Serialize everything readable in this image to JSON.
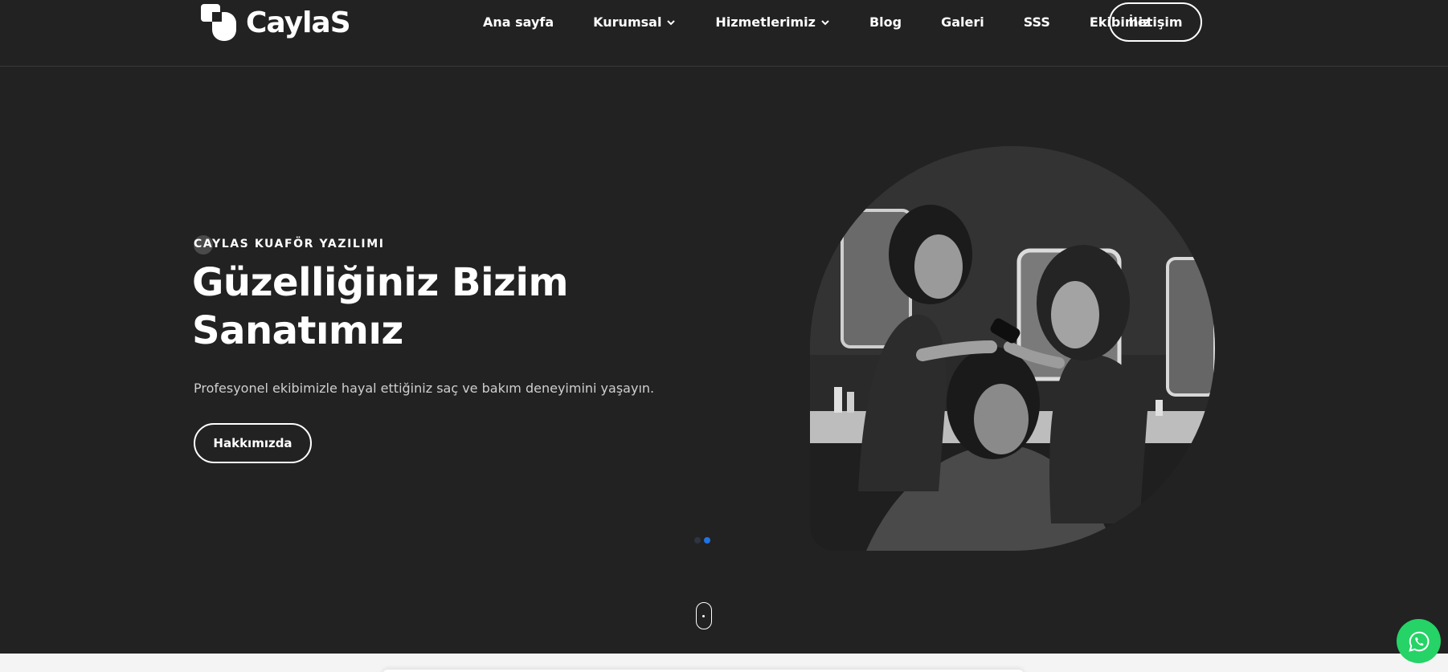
{
  "brand": {
    "name": "CaylaS",
    "logo_icon": "caylas-logo-mark"
  },
  "nav": {
    "items": [
      {
        "label": "Ana sayfa",
        "has_dropdown": false
      },
      {
        "label": "Kurumsal",
        "has_dropdown": true
      },
      {
        "label": "Hizmetlerimiz",
        "has_dropdown": true
      },
      {
        "label": "Blog",
        "has_dropdown": false
      },
      {
        "label": "Galeri",
        "has_dropdown": false
      },
      {
        "label": "SSS",
        "has_dropdown": false
      },
      {
        "label": "Ekibimiz",
        "has_dropdown": false
      }
    ],
    "contact_label": "İletişim"
  },
  "hero": {
    "eyebrow": "CAYLAS KUAFÖR YAZILIMI",
    "title_line1": "Güzelliğiniz Bizim",
    "title_line2": "Sanatımız",
    "subtitle": "Profesyonel ekibimizle hayal ettiğiniz saç ve bakım deneyimini yaşayın.",
    "cta_label": "Hakkımızda",
    "image": "salon-hairdressers-photo",
    "slider": {
      "count": 2,
      "active_index": 1
    }
  },
  "colors": {
    "background": "#222222",
    "accent_dot": "#1e73e8",
    "inactive_dot": "#2e3440",
    "whatsapp": "#25d366"
  },
  "floating": {
    "whatsapp_icon": "whatsapp-icon",
    "scroll_icon": "mouse-scroll-icon"
  }
}
